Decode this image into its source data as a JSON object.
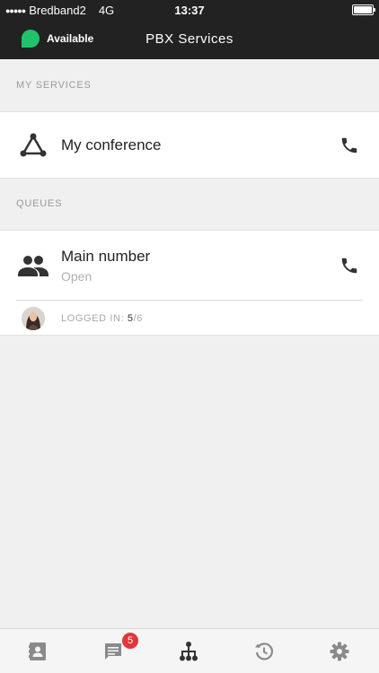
{
  "status_bar": {
    "signal_dots": "●●●●●",
    "carrier": "Bredband2",
    "network": "4G",
    "time": "13:37",
    "battery_level": 1.0
  },
  "header": {
    "presence_label": "Available",
    "presence_color": "#1fc36a",
    "title": "PBX Services"
  },
  "my_services": {
    "section_label": "MY SERVICES",
    "items": [
      {
        "title": "My conference",
        "icon": "conference-icon",
        "action_icon": "phone-icon"
      }
    ]
  },
  "queues": {
    "section_label": "QUEUES",
    "items": [
      {
        "title": "Main number",
        "status": "Open",
        "icon": "group-icon",
        "action_icon": "phone-icon",
        "logged_in_label": "LOGGED IN:",
        "logged_in_count": "5",
        "logged_in_total": "/6"
      }
    ]
  },
  "tab_bar": {
    "tabs": [
      {
        "name": "contacts",
        "icon": "contacts-icon"
      },
      {
        "name": "messages",
        "icon": "chat-icon",
        "badge": "5"
      },
      {
        "name": "pbx-services",
        "icon": "hierarchy-icon",
        "active": true
      },
      {
        "name": "history",
        "icon": "history-icon"
      },
      {
        "name": "settings",
        "icon": "gear-icon"
      }
    ]
  },
  "colors": {
    "header_bg": "#222222",
    "accent_green": "#1fc36a",
    "badge_red": "#e0373c",
    "icon_dark": "#333333",
    "icon_inactive": "#8a8a8a"
  }
}
